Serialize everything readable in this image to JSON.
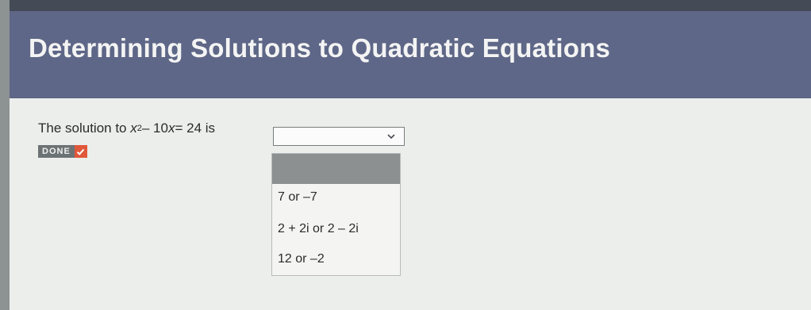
{
  "page": {
    "title": "Determining Solutions to Quadratic Equations"
  },
  "question": {
    "prefix": "The solution to",
    "var_x": "x",
    "exponent": "2",
    "middle": " – 10",
    "var_x2": "x",
    "suffix": " = 24 is"
  },
  "dropdown": {
    "selected": "",
    "options": [
      "",
      "7 or –7",
      "2 + 2i or 2 – 2i",
      "12 or –2"
    ]
  },
  "status": {
    "done_label": "DONE"
  },
  "colors": {
    "header_bg": "#5e6787",
    "done_badge_bg": "#6d7274",
    "done_check_bg": "#e0583a"
  },
  "icons": [
    "chevron-down-icon",
    "checkmark-icon"
  ]
}
